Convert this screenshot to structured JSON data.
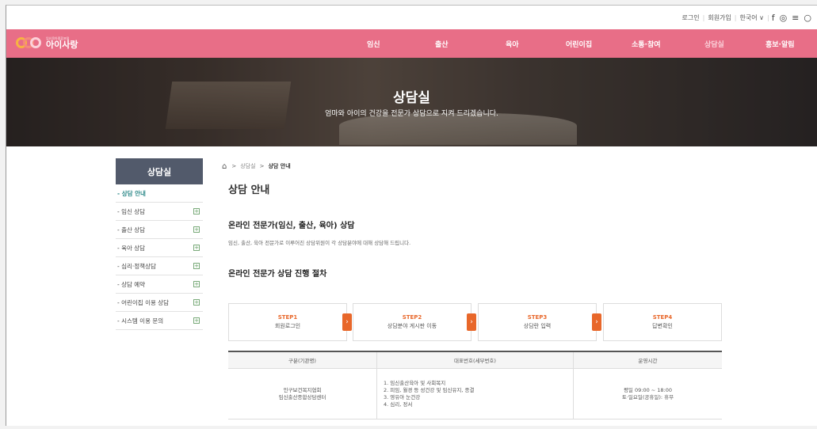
{
  "util": {
    "login": "로그인",
    "join": "회원가입",
    "lang": "한국어",
    "lang_arrow": "∨"
  },
  "logo": {
    "small": "임신육아종합포털",
    "name": "아이사랑"
  },
  "nav": [
    "임신",
    "출산",
    "육아",
    "어린이집",
    "소통·참여",
    "상담실",
    "홍보·알림"
  ],
  "hero": {
    "title": "상담실",
    "subtitle": "엄마와 아이의 건강을 전문가 상담으로 지켜 드리겠습니다."
  },
  "side": {
    "title": "상담실",
    "items": [
      {
        "label": "- 상담 안내",
        "active": true,
        "plus": false
      },
      {
        "label": "- 임신 상담",
        "active": false,
        "plus": true
      },
      {
        "label": "- 출산 상담",
        "active": false,
        "plus": true
      },
      {
        "label": "- 육아 상담",
        "active": false,
        "plus": true
      },
      {
        "label": "- 심리·정책상담",
        "active": false,
        "plus": true
      },
      {
        "label": "- 상담 예약",
        "active": false,
        "plus": true
      },
      {
        "label": "- 어린이집 이용 상담",
        "active": false,
        "plus": true
      },
      {
        "label": "- 시스템 이용 문의",
        "active": false,
        "plus": true
      }
    ]
  },
  "breadcrumb": {
    "sep": ">",
    "level1": "상담실",
    "current": "상담 안내"
  },
  "main": {
    "title": "상담 안내",
    "section1_title": "온라인 전문가(임신, 출산, 육아) 상담",
    "section1_desc": "임신, 출산, 육아 전문가로 이루어진 상담위원이 각 상담분야에 대해 상담해 드립니다.",
    "section2_title": "온라인 전문가 상담 진행 절차"
  },
  "steps": [
    {
      "num": "STEP1",
      "text": "회원로그인"
    },
    {
      "num": "STEP2",
      "text": "상담분야 게시판 이동"
    },
    {
      "num": "STEP3",
      "text": "상담란 입력"
    },
    {
      "num": "STEP4",
      "text": "답변확인"
    }
  ],
  "table": {
    "headers": [
      "구분(기관명)",
      "대표번호(세부번호)",
      "운영시간"
    ],
    "row": {
      "org": [
        "인구보건복지협회",
        "임신출산종합상담센터"
      ],
      "numbers": [
        "1. 임신출산육아 및 사회복지",
        "2. 피임, 월경 등 성건강 및 임신유지, 종결",
        "3. 영유아 눈건강",
        "4. 심리, 정서"
      ],
      "hours": [
        "평일 09:00 ~ 18:00",
        "토·일요일(공휴일): 휴무"
      ]
    }
  },
  "colors": {
    "nav_bg": "#e86e87",
    "side_head": "#525a6b",
    "accent": "#e8672a"
  }
}
